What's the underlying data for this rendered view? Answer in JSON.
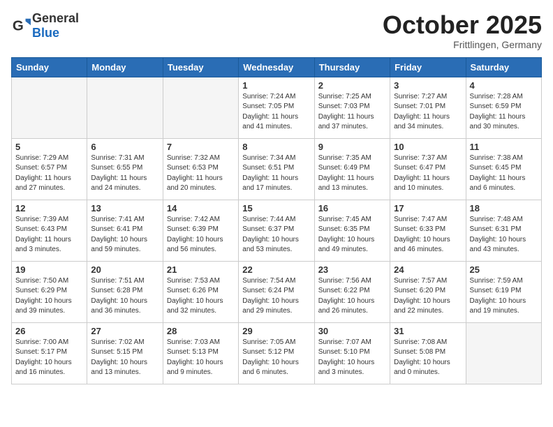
{
  "header": {
    "logo_general": "General",
    "logo_blue": "Blue",
    "month_title": "October 2025",
    "location": "Frittlingen, Germany"
  },
  "weekdays": [
    "Sunday",
    "Monday",
    "Tuesday",
    "Wednesday",
    "Thursday",
    "Friday",
    "Saturday"
  ],
  "weeks": [
    [
      {
        "day": "",
        "info": ""
      },
      {
        "day": "",
        "info": ""
      },
      {
        "day": "",
        "info": ""
      },
      {
        "day": "1",
        "info": "Sunrise: 7:24 AM\nSunset: 7:05 PM\nDaylight: 11 hours\nand 41 minutes."
      },
      {
        "day": "2",
        "info": "Sunrise: 7:25 AM\nSunset: 7:03 PM\nDaylight: 11 hours\nand 37 minutes."
      },
      {
        "day": "3",
        "info": "Sunrise: 7:27 AM\nSunset: 7:01 PM\nDaylight: 11 hours\nand 34 minutes."
      },
      {
        "day": "4",
        "info": "Sunrise: 7:28 AM\nSunset: 6:59 PM\nDaylight: 11 hours\nand 30 minutes."
      }
    ],
    [
      {
        "day": "5",
        "info": "Sunrise: 7:29 AM\nSunset: 6:57 PM\nDaylight: 11 hours\nand 27 minutes."
      },
      {
        "day": "6",
        "info": "Sunrise: 7:31 AM\nSunset: 6:55 PM\nDaylight: 11 hours\nand 24 minutes."
      },
      {
        "day": "7",
        "info": "Sunrise: 7:32 AM\nSunset: 6:53 PM\nDaylight: 11 hours\nand 20 minutes."
      },
      {
        "day": "8",
        "info": "Sunrise: 7:34 AM\nSunset: 6:51 PM\nDaylight: 11 hours\nand 17 minutes."
      },
      {
        "day": "9",
        "info": "Sunrise: 7:35 AM\nSunset: 6:49 PM\nDaylight: 11 hours\nand 13 minutes."
      },
      {
        "day": "10",
        "info": "Sunrise: 7:37 AM\nSunset: 6:47 PM\nDaylight: 11 hours\nand 10 minutes."
      },
      {
        "day": "11",
        "info": "Sunrise: 7:38 AM\nSunset: 6:45 PM\nDaylight: 11 hours\nand 6 minutes."
      }
    ],
    [
      {
        "day": "12",
        "info": "Sunrise: 7:39 AM\nSunset: 6:43 PM\nDaylight: 11 hours\nand 3 minutes."
      },
      {
        "day": "13",
        "info": "Sunrise: 7:41 AM\nSunset: 6:41 PM\nDaylight: 10 hours\nand 59 minutes."
      },
      {
        "day": "14",
        "info": "Sunrise: 7:42 AM\nSunset: 6:39 PM\nDaylight: 10 hours\nand 56 minutes."
      },
      {
        "day": "15",
        "info": "Sunrise: 7:44 AM\nSunset: 6:37 PM\nDaylight: 10 hours\nand 53 minutes."
      },
      {
        "day": "16",
        "info": "Sunrise: 7:45 AM\nSunset: 6:35 PM\nDaylight: 10 hours\nand 49 minutes."
      },
      {
        "day": "17",
        "info": "Sunrise: 7:47 AM\nSunset: 6:33 PM\nDaylight: 10 hours\nand 46 minutes."
      },
      {
        "day": "18",
        "info": "Sunrise: 7:48 AM\nSunset: 6:31 PM\nDaylight: 10 hours\nand 43 minutes."
      }
    ],
    [
      {
        "day": "19",
        "info": "Sunrise: 7:50 AM\nSunset: 6:29 PM\nDaylight: 10 hours\nand 39 minutes."
      },
      {
        "day": "20",
        "info": "Sunrise: 7:51 AM\nSunset: 6:28 PM\nDaylight: 10 hours\nand 36 minutes."
      },
      {
        "day": "21",
        "info": "Sunrise: 7:53 AM\nSunset: 6:26 PM\nDaylight: 10 hours\nand 32 minutes."
      },
      {
        "day": "22",
        "info": "Sunrise: 7:54 AM\nSunset: 6:24 PM\nDaylight: 10 hours\nand 29 minutes."
      },
      {
        "day": "23",
        "info": "Sunrise: 7:56 AM\nSunset: 6:22 PM\nDaylight: 10 hours\nand 26 minutes."
      },
      {
        "day": "24",
        "info": "Sunrise: 7:57 AM\nSunset: 6:20 PM\nDaylight: 10 hours\nand 22 minutes."
      },
      {
        "day": "25",
        "info": "Sunrise: 7:59 AM\nSunset: 6:19 PM\nDaylight: 10 hours\nand 19 minutes."
      }
    ],
    [
      {
        "day": "26",
        "info": "Sunrise: 7:00 AM\nSunset: 5:17 PM\nDaylight: 10 hours\nand 16 minutes."
      },
      {
        "day": "27",
        "info": "Sunrise: 7:02 AM\nSunset: 5:15 PM\nDaylight: 10 hours\nand 13 minutes."
      },
      {
        "day": "28",
        "info": "Sunrise: 7:03 AM\nSunset: 5:13 PM\nDaylight: 10 hours\nand 9 minutes."
      },
      {
        "day": "29",
        "info": "Sunrise: 7:05 AM\nSunset: 5:12 PM\nDaylight: 10 hours\nand 6 minutes."
      },
      {
        "day": "30",
        "info": "Sunrise: 7:07 AM\nSunset: 5:10 PM\nDaylight: 10 hours\nand 3 minutes."
      },
      {
        "day": "31",
        "info": "Sunrise: 7:08 AM\nSunset: 5:08 PM\nDaylight: 10 hours\nand 0 minutes."
      },
      {
        "day": "",
        "info": ""
      }
    ]
  ]
}
